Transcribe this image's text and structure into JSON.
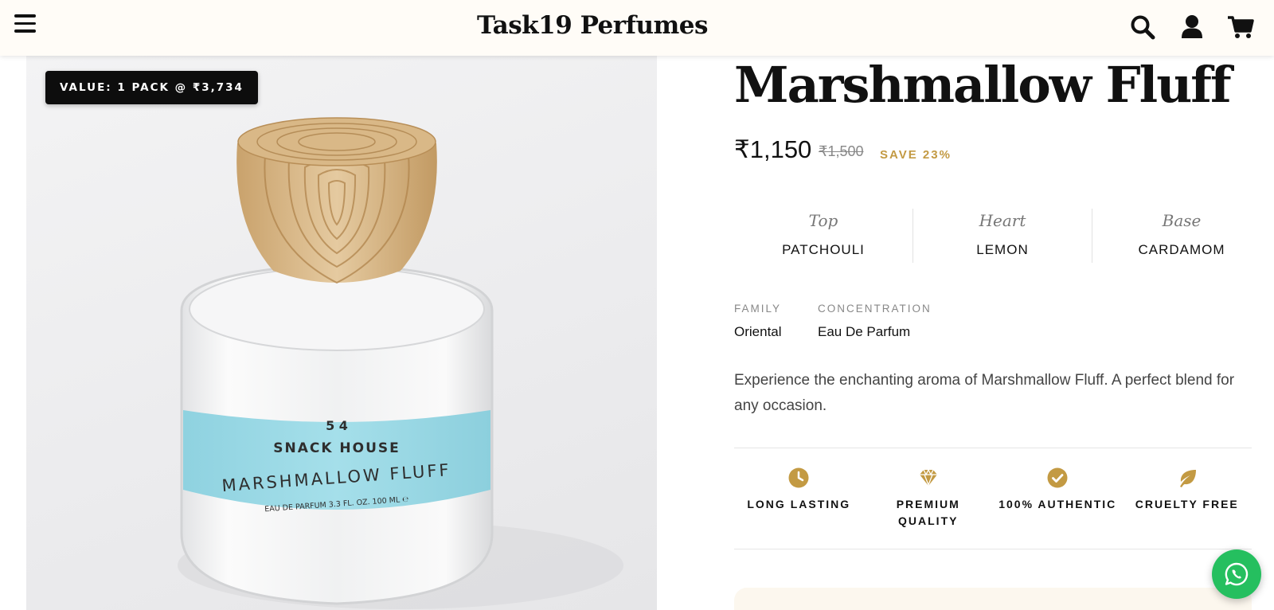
{
  "header": {
    "brand": "Task19 Perfumes",
    "icons": [
      "menu-icon",
      "search-icon",
      "user-icon",
      "cart-icon"
    ]
  },
  "image": {
    "badge": "VALUE: 1 PACK @ ₹3,734",
    "alt": "Marshmallow Fluff perfume bottle",
    "label_brand": "SNACK HOUSE",
    "label_number": "5 4",
    "label_name": "MARSHMALLOW FLUFF",
    "label_detail": "EAU DE PARFUM    3.3 FL. OZ. 100 ML ℮"
  },
  "product": {
    "title": "Marshmallow Fluff",
    "price": "₹1,150",
    "compare_price": "₹1,500",
    "save": "SAVE 23%",
    "notes": [
      {
        "label": "Top",
        "value": "PATCHOULI"
      },
      {
        "label": "Heart",
        "value": "LEMON"
      },
      {
        "label": "Base",
        "value": "CARDAMOM"
      }
    ],
    "family_label": "FAMILY",
    "family": "Oriental",
    "concentration_label": "CONCENTRATION",
    "concentration": "Eau De Parfum",
    "description": "Experience the enchanting aroma of Marshmallow Fluff. A perfect blend for any occasion.",
    "features": [
      {
        "icon": "clock-icon",
        "label": "LONG LASTING"
      },
      {
        "icon": "diamond-icon",
        "label": "PREMIUM QUALITY"
      },
      {
        "icon": "checkmark-icon",
        "label": "100% AUTHENTIC"
      },
      {
        "icon": "leaf-icon",
        "label": "CRUELTY FREE"
      }
    ]
  },
  "colors": {
    "accent_gold": "#c39a43",
    "header_bg": "#fffcf7",
    "whatsapp_green": "#25bf5f",
    "label_blue": "#9ad9e6"
  }
}
